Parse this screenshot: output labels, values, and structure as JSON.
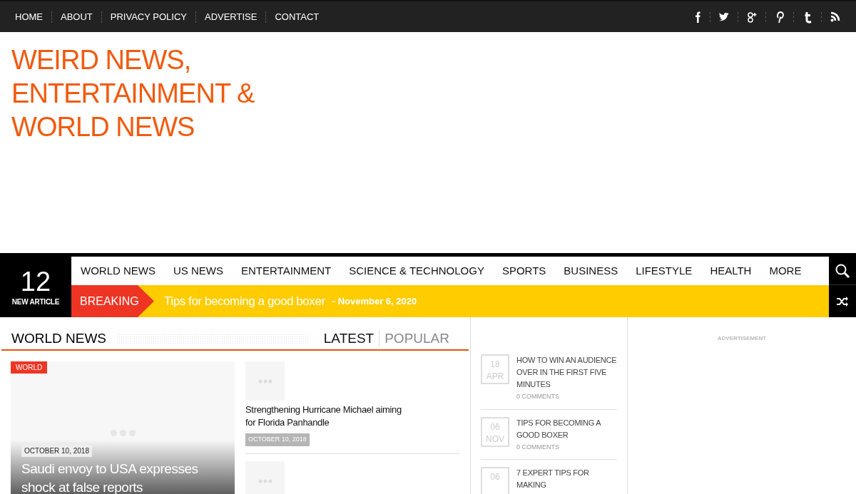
{
  "top_menu": [
    {
      "label": "HOME"
    },
    {
      "label": "ABOUT"
    },
    {
      "label": "PRIVACY POLICY"
    },
    {
      "label": "ADVERTISE"
    },
    {
      "label": "CONTACT"
    }
  ],
  "social": [
    {
      "kind": "facebook"
    },
    {
      "kind": "twitter"
    },
    {
      "kind": "googleplus"
    },
    {
      "kind": "pinterest"
    },
    {
      "kind": "tumblr"
    },
    {
      "kind": "rss"
    }
  ],
  "site_title": "WEIRD NEWS, ENTERTAINMENT & WORLD NEWS",
  "counter": {
    "number": "12",
    "label": "NEW ARTICLE"
  },
  "main_menu": [
    {
      "label": "WORLD NEWS"
    },
    {
      "label": "US NEWS"
    },
    {
      "label": "ENTERTAINMENT"
    },
    {
      "label": "SCIENCE & TECHNOLOGY"
    },
    {
      "label": "SPORTS"
    },
    {
      "label": "BUSINESS"
    },
    {
      "label": "LIFESTYLE"
    },
    {
      "label": "HEALTH"
    },
    {
      "label": "MORE"
    }
  ],
  "breaking": {
    "label": "BREAKING",
    "headline": "Tips for becoming a good boxer",
    "date": "- November 6, 2020"
  },
  "section": {
    "title": "WORLD NEWS",
    "tabs": [
      {
        "label": "LATEST",
        "selected": true
      },
      {
        "label": "POPULAR",
        "selected": false
      }
    ]
  },
  "featured": {
    "tag": "WORLD",
    "date": "OCTOBER 10, 2018",
    "title": "Saudi envoy to USA expresses shock at false reports"
  },
  "list": [
    {
      "kind": "article",
      "title": "Strengthening Hurricane Michael aiming for Florida Panhandle",
      "date": "OCTOBER 10, 2018"
    },
    {
      "kind": "thumbnail"
    }
  ],
  "popular": [
    {
      "day": "18",
      "month": "APR",
      "title": "HOW TO WIN AN AUDIENCE OVER IN THE FIRST FIVE MINUTES",
      "comments": "0 COMMENTS"
    },
    {
      "day": "06",
      "month": "NOV",
      "title": "TIPS FOR BECOMING A GOOD BOXER",
      "comments": "0 COMMENTS"
    },
    {
      "day": "06",
      "title": "7 EXPERT TIPS FOR MAKING"
    }
  ],
  "ad_label": "ADVERTISEMENT"
}
